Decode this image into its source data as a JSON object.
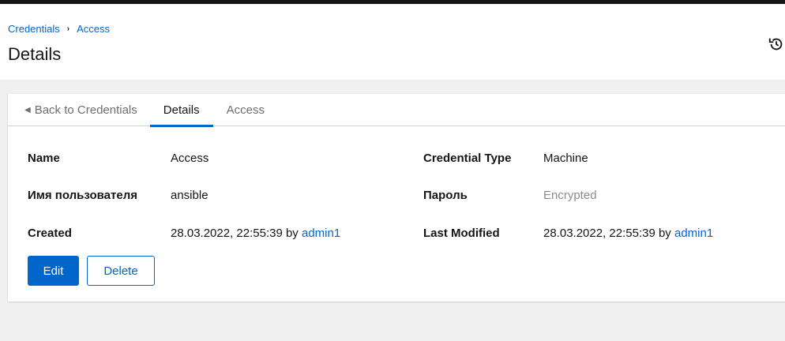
{
  "breadcrumb": {
    "items": [
      "Credentials",
      "Access"
    ],
    "separator": "›"
  },
  "page": {
    "title": "Details",
    "history_icon": "history-icon"
  },
  "tabs": {
    "back_label": "Back to Credentials",
    "details_label": "Details",
    "access_label": "Access",
    "active": "Details"
  },
  "details": {
    "name_label": "Name",
    "name_value": "Access",
    "credential_type_label": "Credential Type",
    "credential_type_value": "Machine",
    "username_label": "Имя пользователя",
    "username_value": "ansible",
    "password_label": "Пароль",
    "password_value": "Encrypted",
    "created_label": "Created",
    "created_date": "28.03.2022, 22:55:39",
    "created_by_word": "by",
    "created_user": "admin1",
    "modified_label": "Last Modified",
    "modified_date": "28.03.2022, 22:55:39",
    "modified_by_word": "by",
    "modified_user": "admin1"
  },
  "actions": {
    "edit_label": "Edit",
    "delete_label": "Delete"
  },
  "colors": {
    "accent": "#0066cc",
    "muted": "#8a8d90",
    "background": "#f0f0f0"
  }
}
